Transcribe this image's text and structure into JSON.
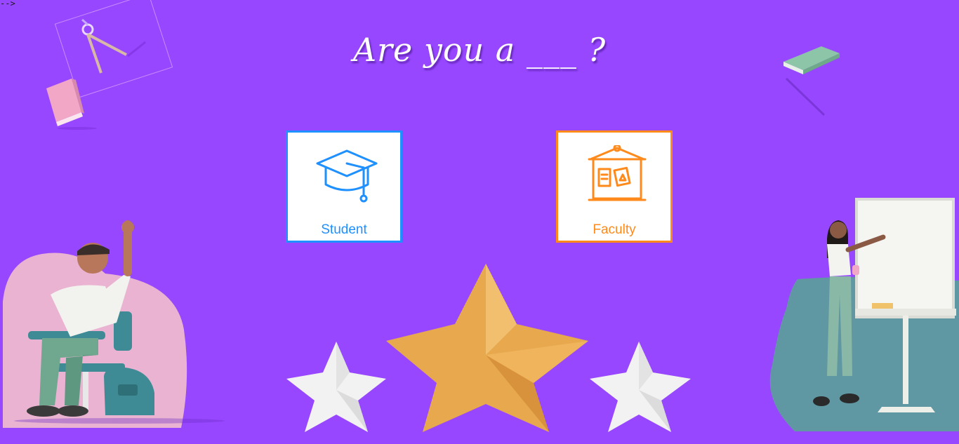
{
  "page": {
    "stray_text": "-->",
    "title": "Are you a ___ ?"
  },
  "roles": {
    "student": {
      "label": "Student",
      "icon": "graduation-cap-icon",
      "color": "#1e90ff"
    },
    "faculty": {
      "label": "Faculty",
      "icon": "presentation-board-icon",
      "color": "#ff8a1c"
    }
  },
  "colors": {
    "background": "#9747ff",
    "student_accent": "#1e90ff",
    "faculty_accent": "#ff8a1c",
    "star_gold": "#e7a84e",
    "star_white": "#f4f4f4"
  },
  "illustrations": [
    "drafting-compass",
    "pink-book",
    "green-book",
    "student-at-desk",
    "teacher-at-whiteboard",
    "stars"
  ]
}
